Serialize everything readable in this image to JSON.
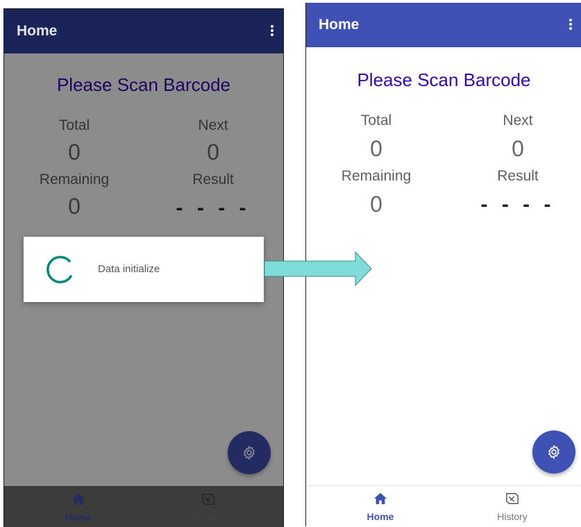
{
  "left_screen": {
    "app_bar": {
      "title": "Home",
      "color": "#1a2458"
    },
    "heading": "Please Scan Barcode",
    "stats": {
      "total_label": "Total",
      "total_value": "0",
      "next_label": "Next",
      "next_value": "0",
      "remaining_label": "Remaining",
      "remaining_value": "0",
      "result_label": "Result",
      "result_value": "- - - -"
    },
    "dialog": {
      "message": "Data initialize",
      "spinner_color": "#00897b"
    },
    "fab_icon": "gear-icon",
    "nav": {
      "home_label": "Home",
      "history_label": "History"
    }
  },
  "right_screen": {
    "app_bar": {
      "title": "Home",
      "color": "#3f51b5"
    },
    "heading": "Please Scan Barcode",
    "stats": {
      "total_label": "Total",
      "total_value": "0",
      "next_label": "Next",
      "next_value": "0",
      "remaining_label": "Remaining",
      "remaining_value": "0",
      "result_label": "Result",
      "result_value": "- - - -"
    },
    "fab_icon": "gear-icon",
    "nav": {
      "home_label": "Home",
      "history_label": "History"
    }
  },
  "colors": {
    "accent": "#3f51b5",
    "heading": "#3508b4",
    "arrow": "#7fdcd8"
  }
}
